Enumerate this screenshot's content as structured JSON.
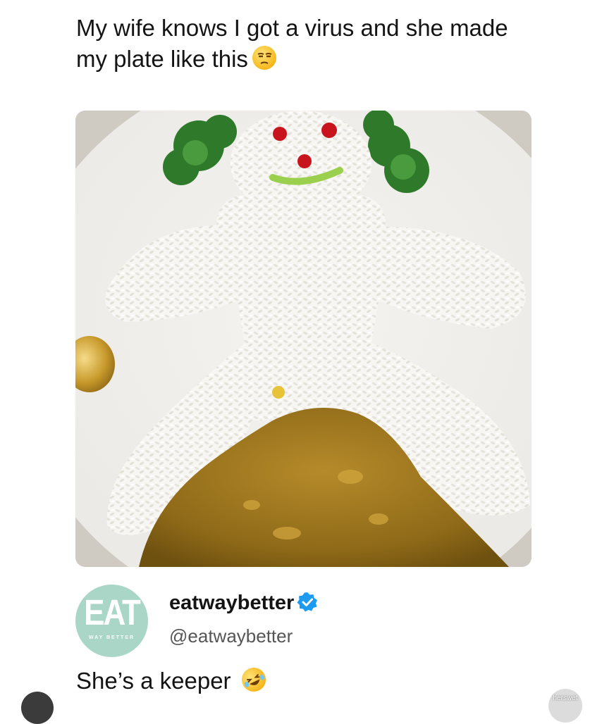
{
  "post": {
    "text": "My wife knows I got a virus and she made my plate like this",
    "emoji": "unamused-face-emoji"
  },
  "profile": {
    "avatar_text": "EAT",
    "avatar_subtext": "WAY BETTER",
    "display_name": "eatwaybetter",
    "handle": "@eatwaybetter",
    "verified": true
  },
  "reply": {
    "text": "She’s a keeper",
    "emoji": "rolling-on-floor-laughing-emoji"
  },
  "watermark": {
    "text": "herswet"
  }
}
